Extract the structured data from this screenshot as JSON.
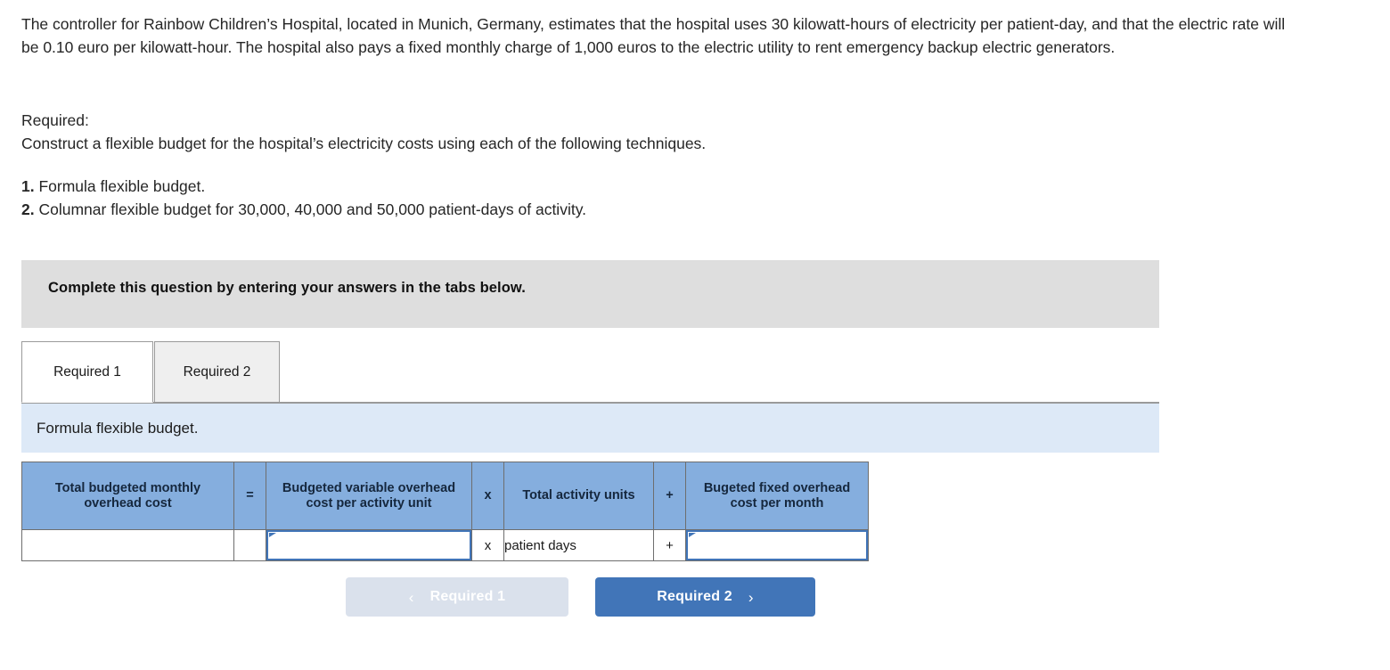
{
  "problem": {
    "statement": "The controller for Rainbow Children’s Hospital, located in Munich, Germany, estimates that the hospital uses 30 kilowatt-hours of electricity per patient-day, and that the electric rate will be 0.10 euro per kilowatt-hour. The hospital also pays a fixed monthly charge of 1,000 euros to the electric utility to rent emergency backup electric generators.",
    "required_label": "Required:",
    "required_text": "Construct a flexible budget for the hospital’s electricity costs using each of the following techniques.",
    "items": [
      {
        "num": "1.",
        "text": "Formula flexible budget."
      },
      {
        "num": "2.",
        "text": "Columnar flexible budget for 30,000, 40,000 and 50,000 patient-days of activity."
      }
    ]
  },
  "instruction_banner": {
    "text": "Complete this question by entering your answers in the tabs below."
  },
  "tabs": [
    {
      "label": "Required 1",
      "active": true
    },
    {
      "label": "Required 2",
      "active": false
    }
  ],
  "subbar": {
    "text": "Formula flexible budget."
  },
  "formula_table": {
    "headers": [
      "Total budgeted monthly overhead cost",
      "=",
      "Budgeted variable overhead cost per activity unit",
      "x",
      "Total activity units",
      "+",
      "Bugeted fixed overhead cost per month"
    ],
    "row": {
      "total_budgeted_cost": "",
      "equals_operator": "",
      "variable_cost_per_unit": "",
      "multiply_operator": "x",
      "activity_units": "patient days",
      "plus_operator": "+",
      "fixed_cost_per_month": ""
    }
  },
  "nav": {
    "prev_label": "Required 1",
    "prev_icon": "chevron-left-icon",
    "prev_glyph": "‹",
    "next_label": "Required 2",
    "next_icon": "chevron-right-icon",
    "next_glyph": "›"
  },
  "colors": {
    "header_blue": "#85aede",
    "subbar_blue": "#dde9f7",
    "banner_gray": "#dedede",
    "accent_blue": "#4175b8",
    "disabled_blue": "#dae1ec"
  }
}
